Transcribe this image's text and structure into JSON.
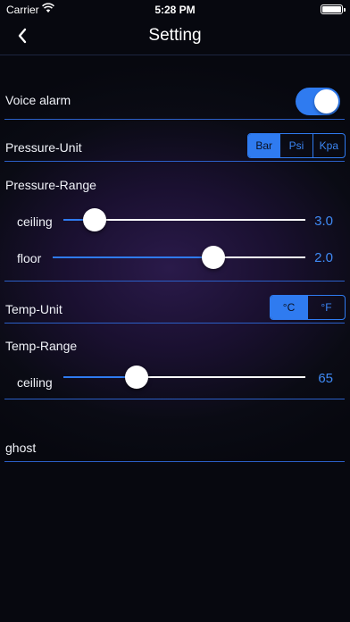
{
  "status_bar": {
    "carrier": "Carrier",
    "time": "5:28 PM",
    "battery_level": 1.0
  },
  "nav": {
    "title": "Setting"
  },
  "voice_alarm": {
    "label": "Voice alarm",
    "enabled": true
  },
  "pressure_unit": {
    "label": "Pressure-Unit",
    "options": [
      "Bar",
      "Psi",
      "Kpa"
    ],
    "selected": "Bar"
  },
  "pressure_range": {
    "label": "Pressure-Range",
    "ceiling": {
      "label": "ceiling",
      "value": "3.0",
      "fraction": 0.09
    },
    "floor": {
      "label": "floor",
      "value": "2.0",
      "fraction": 0.65
    }
  },
  "temp_unit": {
    "label": "Temp-Unit",
    "options": [
      "°C",
      "°F"
    ],
    "selected": "°C"
  },
  "temp_range": {
    "label": "Temp-Range",
    "ceiling": {
      "label": "ceiling",
      "value": "65",
      "fraction": 0.28
    }
  },
  "ghost": {
    "label": "ghost"
  },
  "colors": {
    "accent": "#2f7bf0",
    "value_text": "#3f8af5",
    "divider": "#2b5fc7"
  }
}
